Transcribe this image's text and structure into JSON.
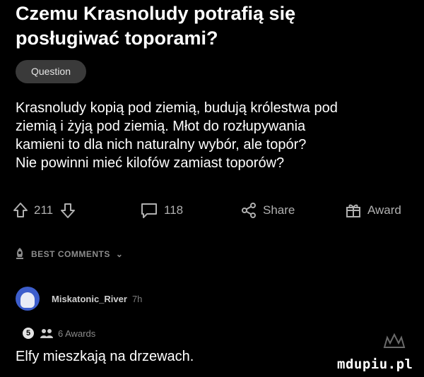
{
  "post": {
    "title_lines": [
      "Czemu Krasnoludy potrafią się",
      "posługiwać toporami?"
    ],
    "tag": "Question",
    "body_lines": [
      "Krasnoludy kopią pod ziemią, budują królestwa pod",
      "ziemią i żyją pod ziemią. Młot do rozłupywania",
      "kamieni to dla nich naturalny wybór, ale topór?",
      "Nie powinni mieć kilofów zamiast toporów?"
    ]
  },
  "actions": {
    "votes": "211",
    "comments": "118",
    "share": "Share",
    "award": "Award"
  },
  "best_comments": {
    "label": "BEST COMMENTS",
    "chevron": "⌄"
  },
  "comment": {
    "username": "Miskatonic_River",
    "time": "7h",
    "awards_label": "6 Awards",
    "text": "Elfy mieszkają na drzewach."
  },
  "watermark": "mdupiu.pl",
  "colors": {
    "background": "#000000",
    "text": "#ffffff",
    "muted": "#b0b0b0",
    "tag_bg": "#3a3a3a",
    "avatar": "#3d5ecc"
  }
}
